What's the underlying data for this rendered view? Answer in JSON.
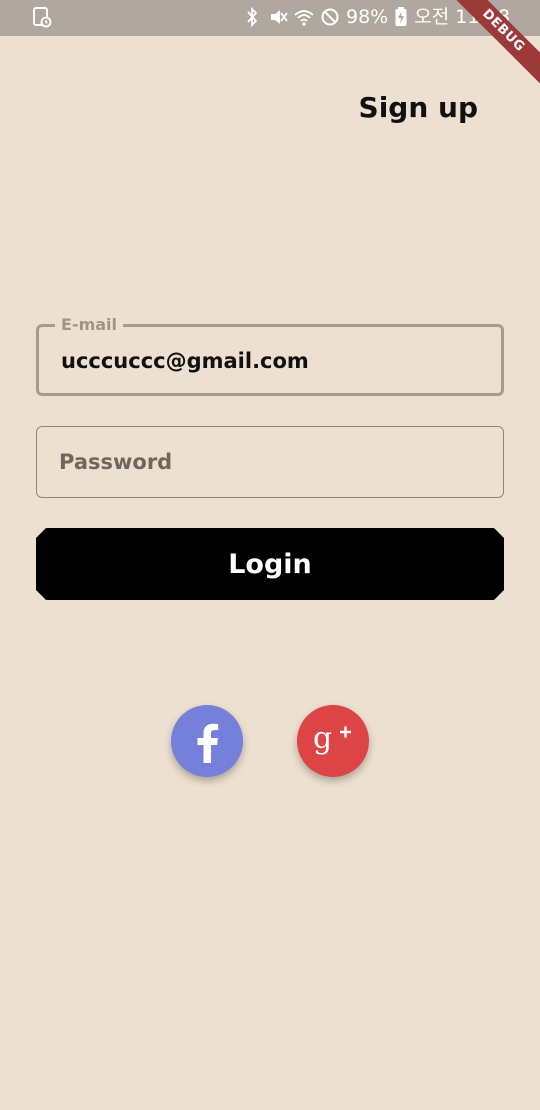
{
  "status_bar": {
    "battery_percent": "98%",
    "time": "오전 11:48",
    "icons": [
      "notification-icon",
      "bluetooth-icon",
      "mute-icon",
      "wifi-icon",
      "do-not-disturb-icon",
      "battery-charging-icon"
    ]
  },
  "debug_banner": "DEBUG",
  "header": {
    "signup_label": "Sign up"
  },
  "form": {
    "email": {
      "label": "E-mail",
      "value": "ucccuccc@gmail.com"
    },
    "password": {
      "placeholder": "Password",
      "value": ""
    },
    "login_label": "Login"
  },
  "social": {
    "facebook_icon": "facebook-icon",
    "google_icon": "google-plus-icon",
    "facebook_color": "#7480d9",
    "google_color": "#dc4445"
  },
  "colors": {
    "background": "#ede0d0",
    "status_bar": "#b0a89e",
    "button": "#000000"
  }
}
